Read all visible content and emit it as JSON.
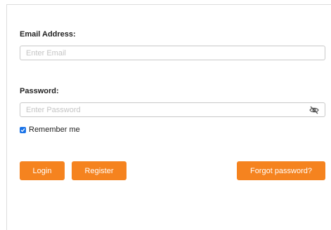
{
  "form": {
    "email_label": "Email Address:",
    "email_placeholder": "Enter Email",
    "email_value": "",
    "password_label": "Password:",
    "password_placeholder": "Enter Password",
    "password_value": "",
    "password_toggle_icon": "eye-slash-icon",
    "remember_label": "Remember me",
    "remember_checked": true
  },
  "buttons": {
    "login_label": "Login",
    "register_label": "Register",
    "forgot_label": "Forgot password?"
  },
  "colors": {
    "accent": "#f5831f",
    "checkbox": "#1a73e8"
  }
}
